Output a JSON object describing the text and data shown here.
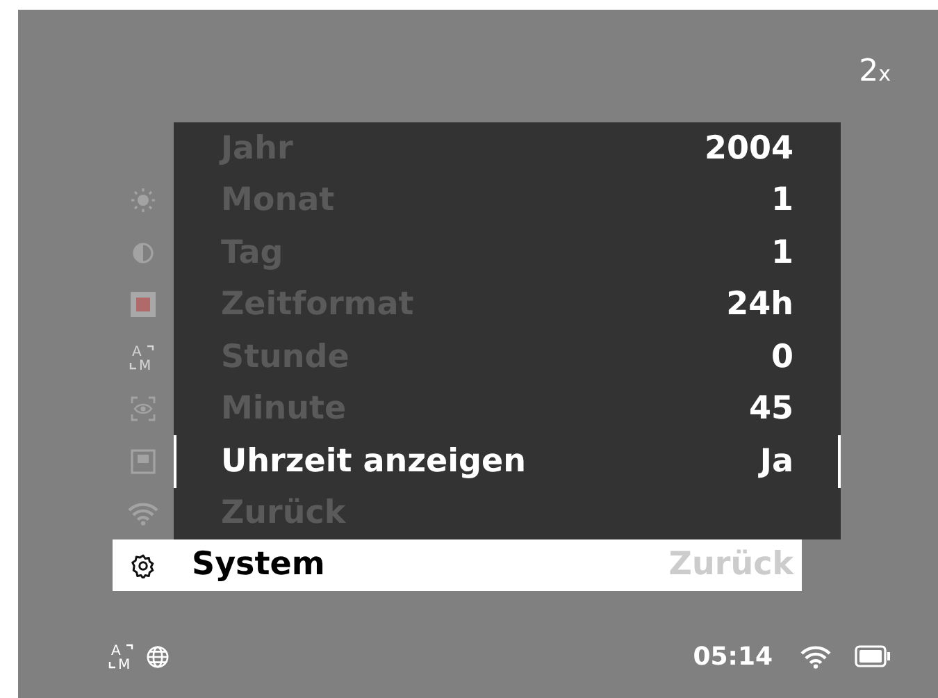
{
  "zoom": {
    "value": "2",
    "unit": "x"
  },
  "side_icons": {
    "auto_mode": {
      "top": "A",
      "bottom": "M"
    }
  },
  "menu": {
    "items": [
      {
        "label": "Jahr",
        "value": "2004",
        "selected": false
      },
      {
        "label": "Monat",
        "value": "1",
        "selected": false
      },
      {
        "label": "Tag",
        "value": "1",
        "selected": false
      },
      {
        "label": "Zeitformat",
        "value": "24h",
        "selected": false
      },
      {
        "label": "Stunde",
        "value": "0",
        "selected": false
      },
      {
        "label": "Minute",
        "value": "45",
        "selected": false
      },
      {
        "label": "Uhrzeit anzeigen",
        "value": "Ja",
        "selected": true
      },
      {
        "label": "Zurück",
        "selected": false
      }
    ]
  },
  "category": {
    "label": "System",
    "hint": "Zurück"
  },
  "status_bar": {
    "auto_mode": {
      "top": "A",
      "bottom": "M"
    },
    "time": "05:14"
  }
}
